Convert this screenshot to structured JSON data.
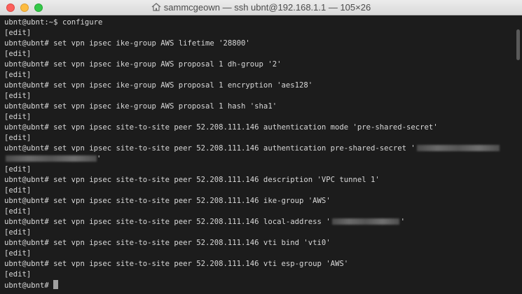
{
  "window": {
    "title": "sammcgeown — ssh ubnt@192.168.1.1 — 105×26"
  },
  "terminal": {
    "prompt": "ubnt@ubnt:~$",
    "config_prompt": "ubnt@ubnt#",
    "edit_marker": "[edit]",
    "first_command": "configure",
    "commands": [
      "set vpn ipsec ike-group AWS lifetime '28800'",
      "set vpn ipsec ike-group AWS proposal 1 dh-group '2'",
      "set vpn ipsec ike-group AWS proposal 1 encryption 'aes128'",
      "set vpn ipsec ike-group AWS proposal 1 hash 'sha1'",
      "set vpn ipsec site-to-site peer 52.208.111.146 authentication mode 'pre-shared-secret'",
      "set vpn ipsec site-to-site peer 52.208.111.146 authentication pre-shared-secret '",
      "'",
      "set vpn ipsec site-to-site peer 52.208.111.146 description 'VPC tunnel 1'",
      "set vpn ipsec site-to-site peer 52.208.111.146 ike-group 'AWS'",
      "set vpn ipsec site-to-site peer 52.208.111.146 local-address '",
      "'",
      "set vpn ipsec site-to-site peer 52.208.111.146 vti bind 'vti0'",
      "set vpn ipsec site-to-site peer 52.208.111.146 vti esp-group 'AWS'"
    ]
  }
}
